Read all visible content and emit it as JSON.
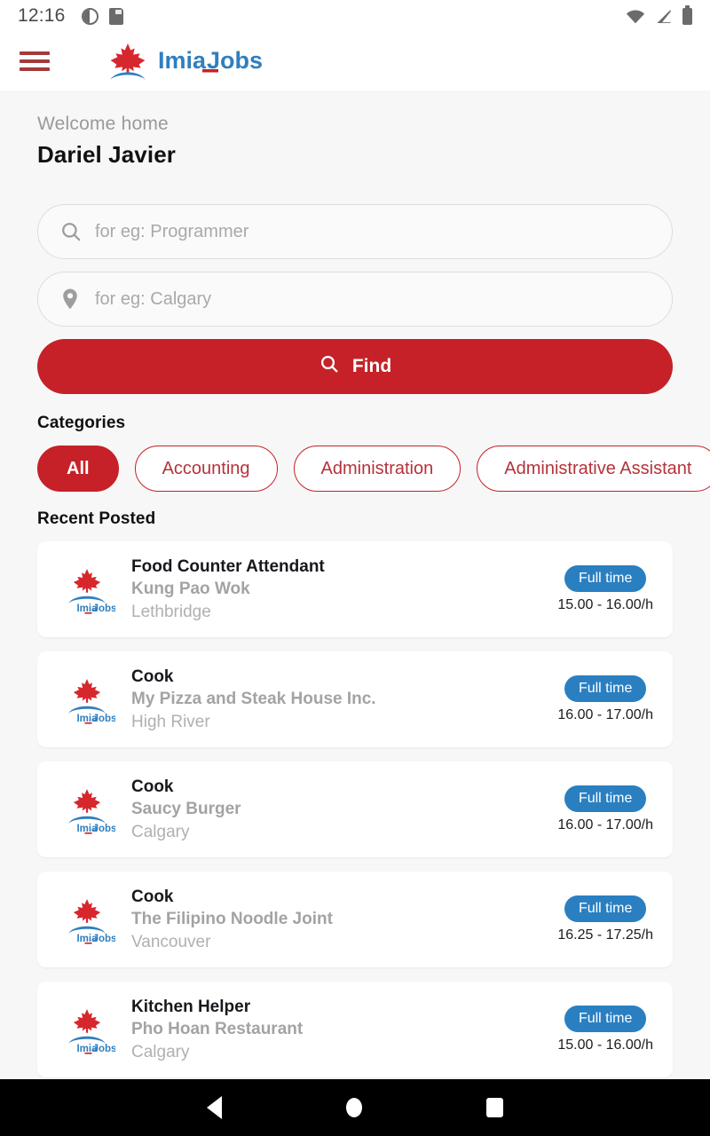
{
  "statusbar": {
    "time": "12:16",
    "left_icons": [
      "do-not-disturb-icon",
      "sd-card-icon"
    ],
    "right_icons": [
      "wifi-icon",
      "cellular-signal-icon",
      "battery-icon"
    ]
  },
  "appbar": {
    "menu_icon": "hamburger-menu-icon",
    "logo_alt": "ImiaJobs",
    "logo_text_part1": "Imia",
    "logo_text_part2": "Jobs"
  },
  "welcome": {
    "greeting": "Welcome home",
    "name": "Dariel Javier"
  },
  "search": {
    "keyword_placeholder": "for eg: Programmer",
    "keyword_value": "",
    "location_placeholder": "for eg: Calgary",
    "location_value": "",
    "find_label": "Find",
    "search_icon": "search-icon",
    "location_icon": "map-pin-icon"
  },
  "categories": {
    "title": "Categories",
    "items": [
      {
        "label": "All",
        "active": true
      },
      {
        "label": "Accounting",
        "active": false
      },
      {
        "label": "Administration",
        "active": false
      },
      {
        "label": "Administrative Assistant",
        "active": false
      }
    ]
  },
  "recent": {
    "title": "Recent Posted",
    "jobs": [
      {
        "title": "Food Counter Attendant",
        "company": "Kung Pao Wok",
        "city": "Lethbridge",
        "badge": "Full time",
        "salary": "15.00 - 16.00/h"
      },
      {
        "title": "Cook",
        "company": "My Pizza and Steak House Inc.",
        "city": "High River",
        "badge": "Full time",
        "salary": "16.00 - 17.00/h"
      },
      {
        "title": "Cook",
        "company": "Saucy Burger",
        "city": "Calgary",
        "badge": "Full time",
        "salary": "16.00 - 17.00/h"
      },
      {
        "title": "Cook",
        "company": "The Filipino Noodle Joint",
        "city": "Vancouver",
        "badge": "Full time",
        "salary": "16.25 - 17.25/h"
      },
      {
        "title": "Kitchen Helper",
        "company": "Pho Hoan Restaurant",
        "city": "Calgary",
        "badge": "Full time",
        "salary": "15.00 - 16.00/h"
      }
    ]
  },
  "navbar": {
    "back": "back-nav-icon",
    "home": "home-nav-icon",
    "recents": "recents-nav-icon"
  },
  "colors": {
    "brand_red": "#c62128",
    "brand_blue": "#2a7fc1",
    "logo_blue": "#2f7fbf",
    "page_bg": "#f7f7f8",
    "card_bg": "#ffffff"
  }
}
